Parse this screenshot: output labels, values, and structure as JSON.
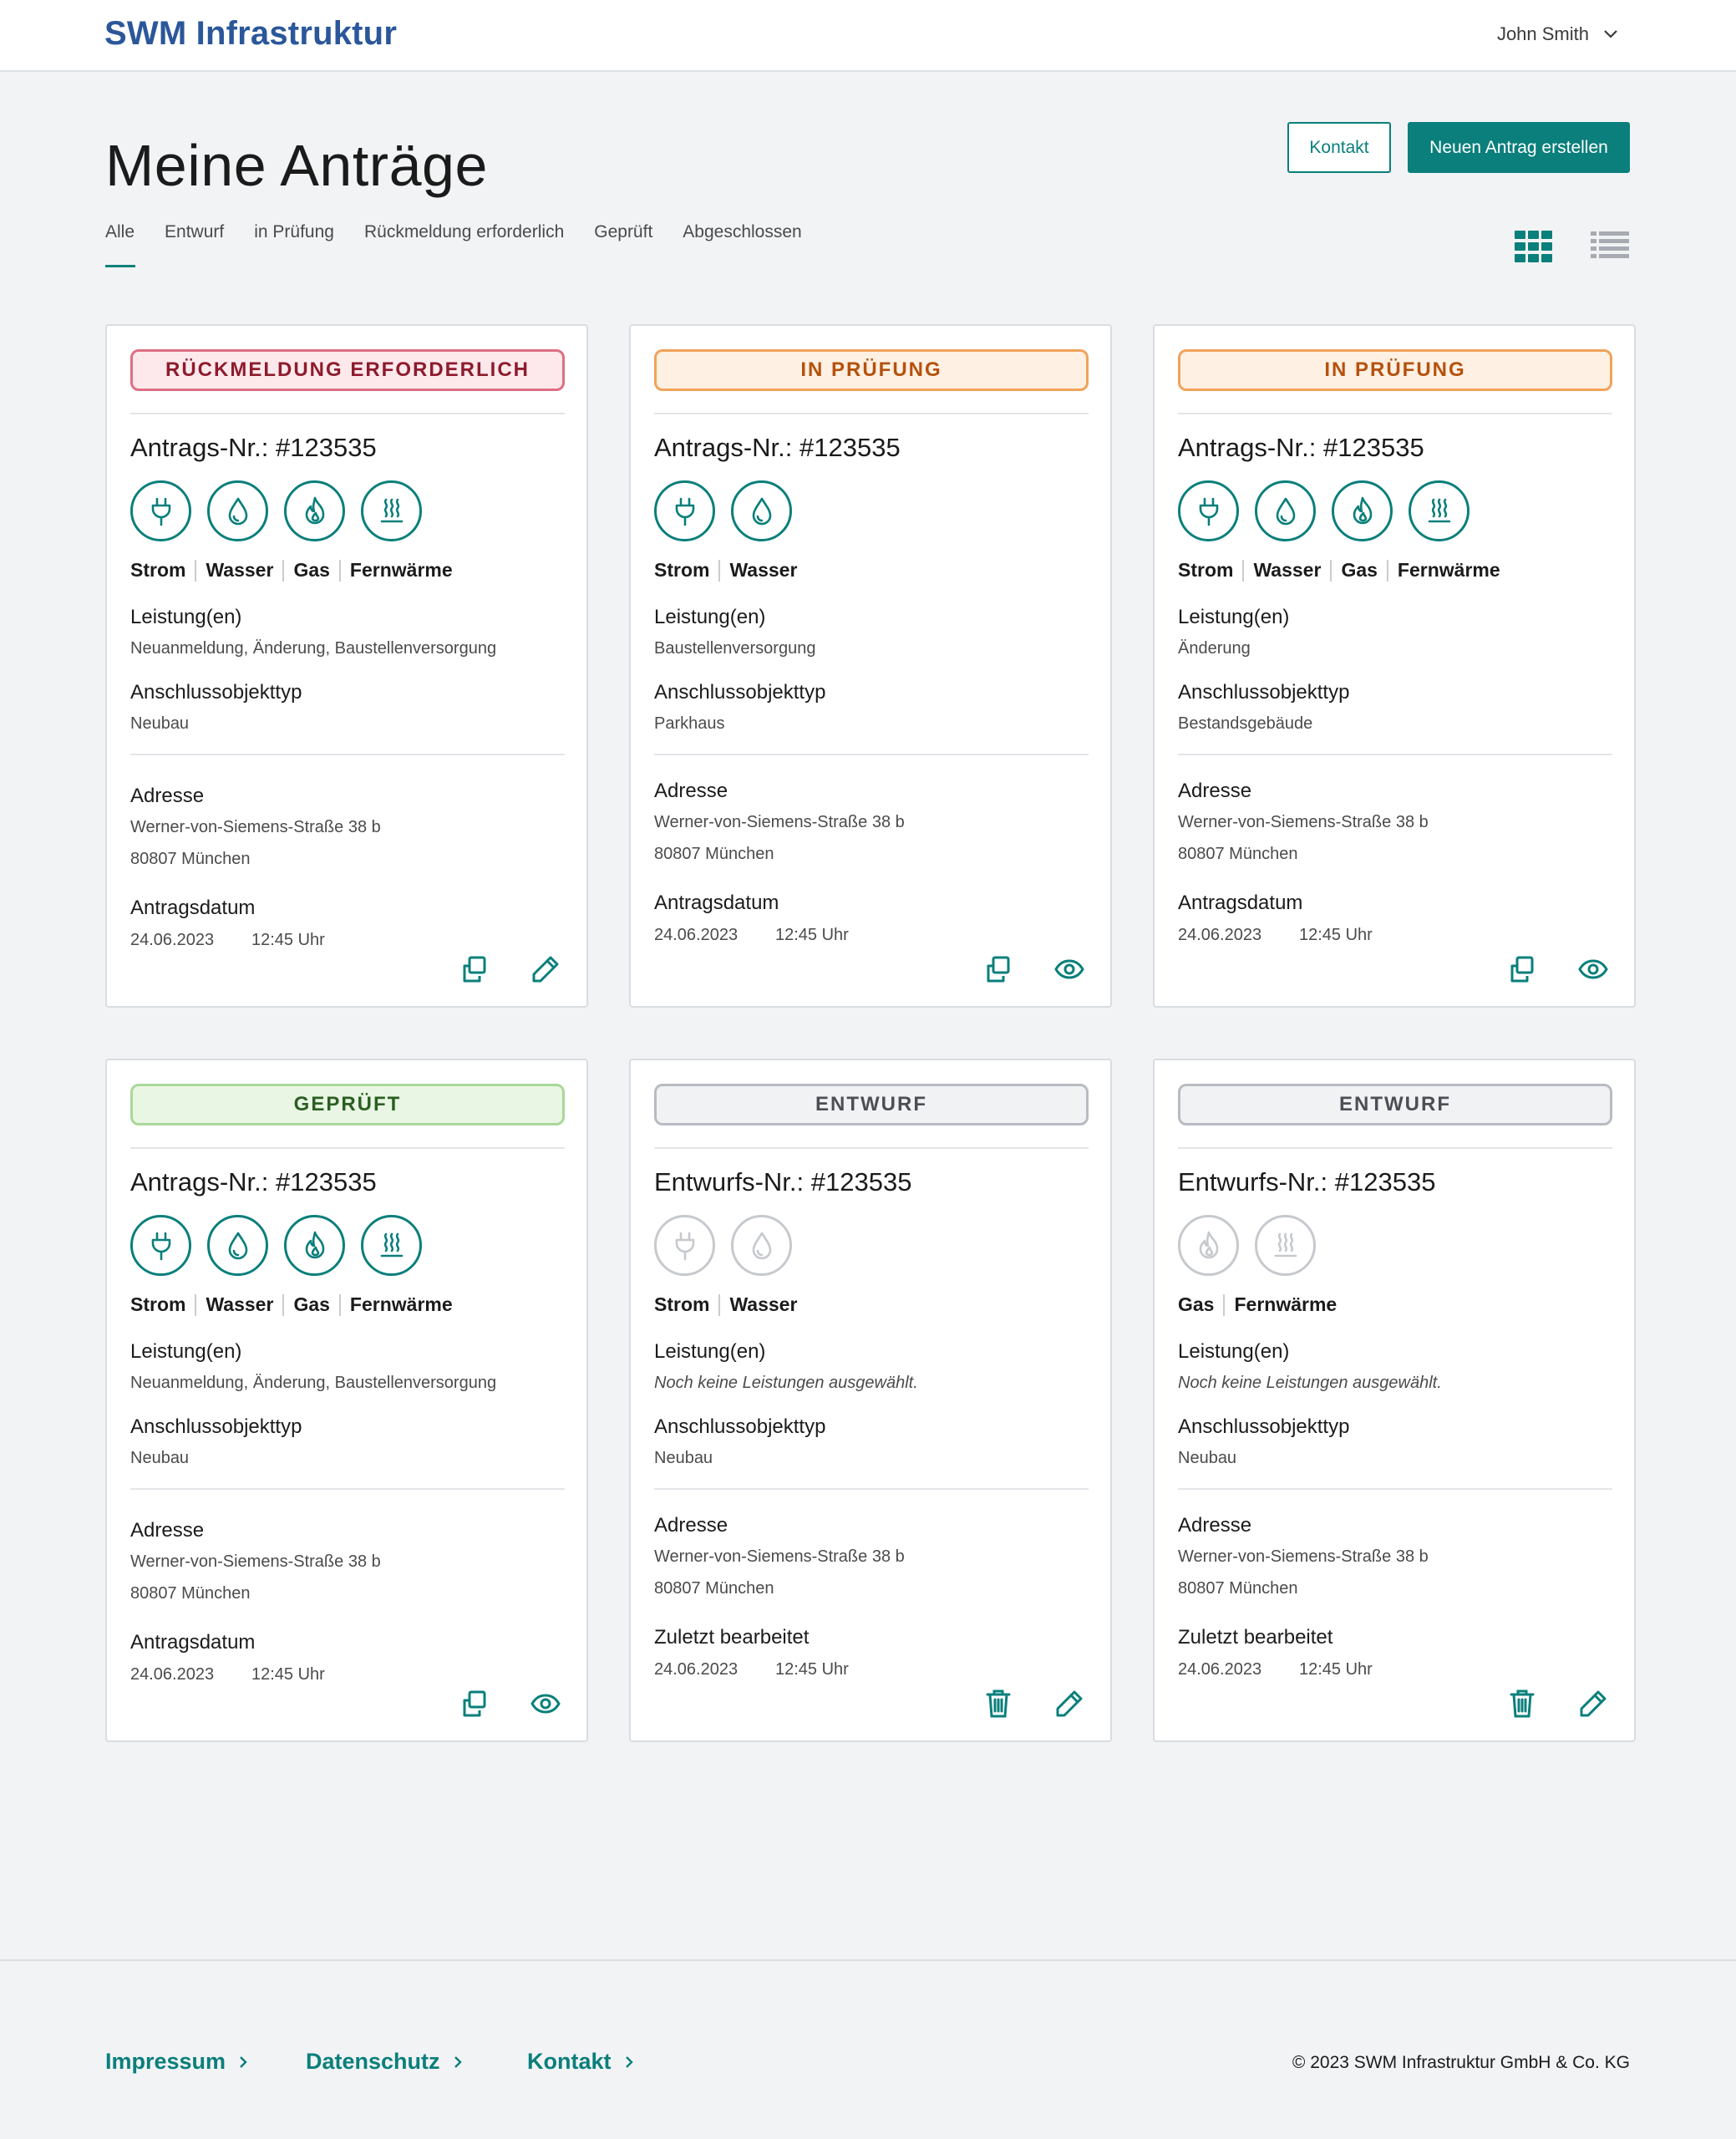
{
  "header": {
    "brand": "SWM Infrastruktur",
    "user_name": "John Smith"
  },
  "page": {
    "title": "Meine Anträge",
    "contact_button": "Kontakt",
    "new_button": "Neuen Antrag erstellen",
    "tabs": [
      "Alle",
      "Entwurf",
      "in Prüfung",
      "Rückmeldung erforderlich",
      "Geprüft",
      "Abgeschlossen"
    ],
    "active_tab": "Alle"
  },
  "labels": {
    "leistungen": "Leistung(en)",
    "anschlussobjekttyp": "Anschlussobjekttyp",
    "adresse": "Adresse",
    "antragsdatum": "Antragsdatum",
    "zuletzt_bearbeitet": "Zuletzt bearbeitet"
  },
  "cards": [
    {
      "status": "RÜCKMELDUNG ERFORDERLICH",
      "status_color": "#de6f83",
      "number": "Antrags-Nr.: #123535",
      "media": [
        "Strom",
        "Wasser",
        "Gas",
        "Fernwärme"
      ],
      "icons": [
        "plug-icon",
        "water-drop-icon",
        "flame-icon",
        "heat-waves-icon"
      ],
      "leistungen": "Neuanmeldung, Änderung, Baustellenversorgung",
      "objekttyp": "Neubau",
      "street": "Werner-von-Siemens-Straße 38 b",
      "city": "80807 München",
      "date": "24.06.2023",
      "time": "12:45 Uhr",
      "actions": [
        "copy-icon",
        "edit-pencil-icon"
      ]
    },
    {
      "status": "IN PRÜFUNG",
      "status_color": "#f0a35a",
      "number": "Antrags-Nr.: #123535",
      "media": [
        "Strom",
        "Wasser"
      ],
      "icons": [
        "plug-icon",
        "water-drop-icon"
      ],
      "leistungen": "Baustellenversorgung",
      "objekttyp": "Parkhaus",
      "street": "Werner-von-Siemens-Straße 38 b",
      "city": "80807 München",
      "date": "24.06.2023",
      "time": "12:45 Uhr",
      "actions": [
        "copy-icon",
        "eye-icon"
      ]
    },
    {
      "status": "IN PRÜFUNG",
      "status_color": "#f0a35a",
      "number": "Antrags-Nr.: #123535",
      "media": [
        "Strom",
        "Wasser",
        "Gas",
        "Fernwärme"
      ],
      "icons": [
        "plug-icon",
        "water-drop-icon",
        "flame-icon",
        "heat-waves-icon"
      ],
      "leistungen": "Änderung",
      "objekttyp": "Bestandsgebäude",
      "street": "Werner-von-Siemens-Straße 38 b",
      "city": "80807 München",
      "date": "24.06.2023",
      "time": "12:45 Uhr",
      "actions": [
        "copy-icon",
        "eye-icon"
      ]
    },
    {
      "status": "GEPRÜFT",
      "status_color": "#a9d89b",
      "number": "Antrags-Nr.: #123535",
      "media": [
        "Strom",
        "Wasser",
        "Gas",
        "Fernwärme"
      ],
      "icons": [
        "plug-icon",
        "water-drop-icon",
        "flame-icon",
        "heat-waves-icon"
      ],
      "leistungen": "Neuanmeldung, Änderung, Baustellenversorgung",
      "objekttyp": "Neubau",
      "street": "Werner-von-Siemens-Straße 38 b",
      "city": "80807 München",
      "date": "24.06.2023",
      "time": "12:45 Uhr",
      "actions": [
        "copy-icon",
        "eye-icon"
      ]
    },
    {
      "status": "ENTWURF",
      "status_color": "#b8bcc2",
      "number": "Entwurfs-Nr.: #123535",
      "media": [
        "Strom",
        "Wasser"
      ],
      "icons": [
        "plug-icon",
        "water-drop-icon"
      ],
      "leistungen": "Noch keine Leistungen ausgewählt.",
      "objekttyp": "Neubau",
      "street": "Werner-von-Siemens-Straße 38 b",
      "city": "80807 München",
      "date": "24.06.2023",
      "time": "12:45 Uhr",
      "actions": [
        "trash-icon",
        "edit-pencil-icon"
      ]
    },
    {
      "status": "ENTWURF",
      "status_color": "#b8bcc2",
      "number": "Entwurfs-Nr.: #123535",
      "media": [
        "Gas",
        "Fernwärme"
      ],
      "icons": [
        "flame-icon",
        "heat-waves-icon"
      ],
      "leistungen": "Noch keine Leistungen ausgewählt.",
      "objekttyp": "Neubau",
      "street": "Werner-von-Siemens-Straße 38 b",
      "city": "80807 München",
      "date": "24.06.2023",
      "time": "12:45 Uhr",
      "actions": [
        "trash-icon",
        "edit-pencil-icon"
      ]
    }
  ],
  "footer": {
    "links": [
      "Impressum",
      "Datenschutz",
      "Kontakt"
    ],
    "copyright": "© 2023 SWM Infrastruktur GmbH & Co. KG"
  }
}
